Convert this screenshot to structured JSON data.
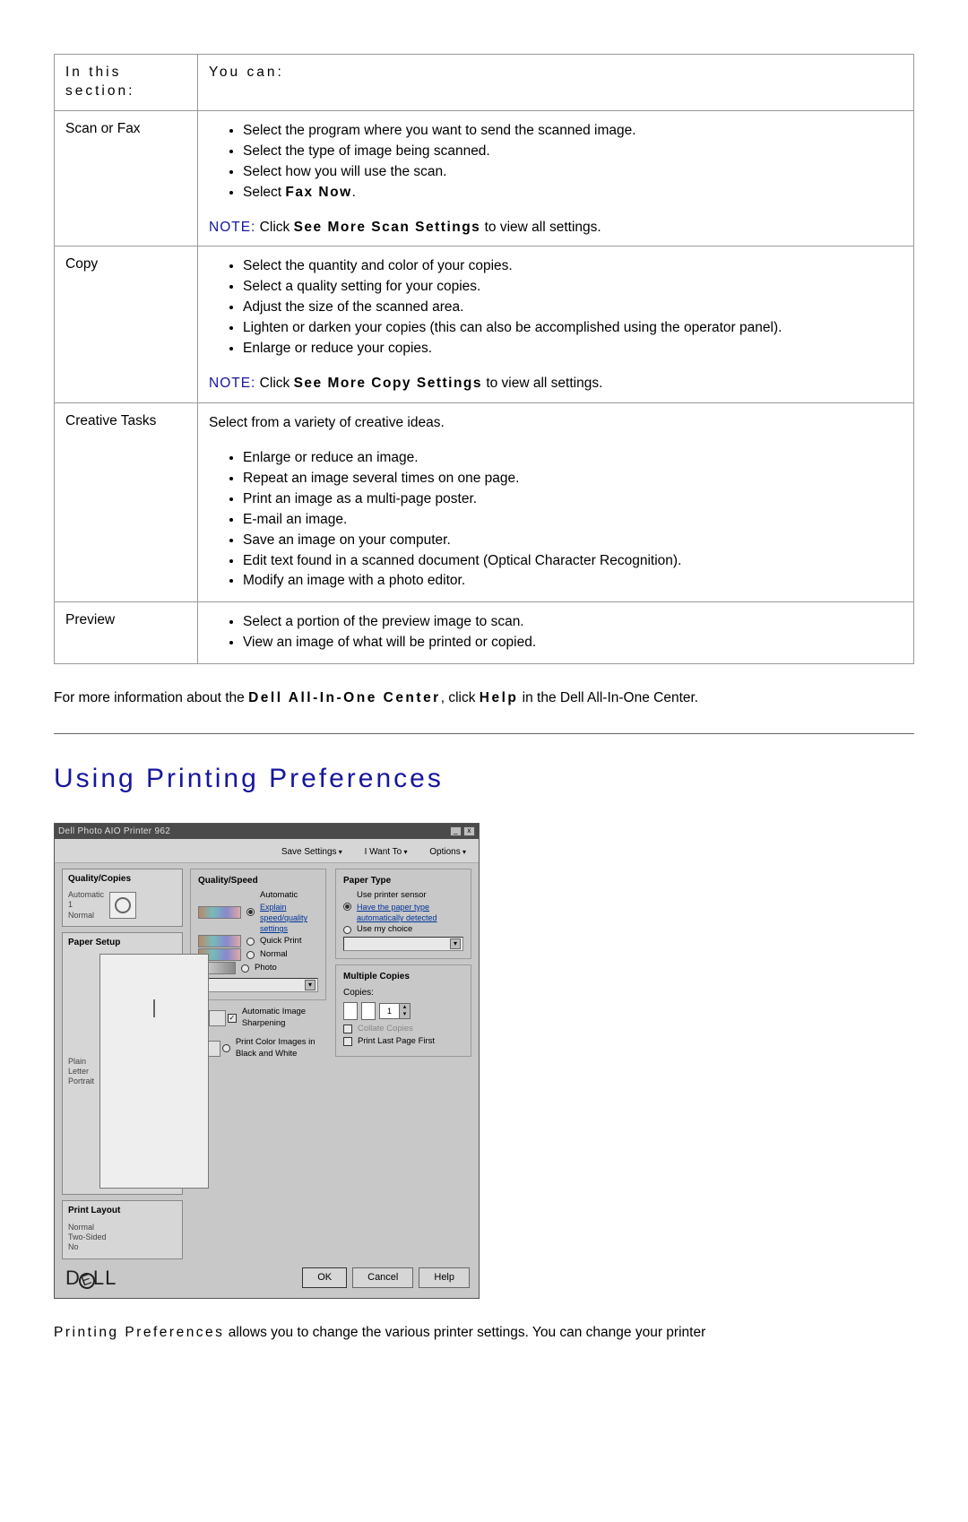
{
  "table": {
    "header": {
      "col1": "In this section:",
      "col2": "You can:"
    },
    "rows": {
      "scan": {
        "label": "Scan or Fax",
        "items": [
          "Select the program where you want to send the scanned image.",
          "Select the type of image being scanned.",
          "Select how you will use the scan."
        ],
        "last_pre": "Select ",
        "last_bold": "Fax Now",
        "last_post": ".",
        "note_label": "NOTE:",
        "note_pre": " Click ",
        "note_bold": "See More Scan Settings",
        "note_post": " to view all settings."
      },
      "copy": {
        "label": "Copy",
        "items": [
          "Select the quantity and color of your copies.",
          "Select a quality setting for your copies.",
          "Adjust the size of the scanned area.",
          "Lighten or darken your copies (this can also be accomplished using the operator panel).",
          "Enlarge or reduce your copies."
        ],
        "note_label": "NOTE:",
        "note_pre": " Click ",
        "note_bold": "See More Copy Settings",
        "note_post": " to view all settings."
      },
      "creative": {
        "label": "Creative Tasks",
        "intro": "Select from a variety of creative ideas.",
        "items": [
          "Enlarge or reduce an image.",
          "Repeat an image several times on one page.",
          "Print an image as a multi-page poster.",
          "E-mail an image.",
          "Save an image on your computer.",
          "Edit text found in a scanned document (Optical Character Recognition).",
          "Modify an image with a photo editor."
        ]
      },
      "preview": {
        "label": "Preview",
        "items": [
          "Select a portion of the preview image to scan.",
          "View an image of what will be printed or copied."
        ]
      }
    }
  },
  "more_info": {
    "pre": "For more information about the ",
    "bold1": "Dell All-In-One Center",
    "mid": ", click ",
    "bold2": "Help",
    "post": " in the Dell All-In-One Center."
  },
  "section_title": "Using Printing Preferences",
  "dialog": {
    "title": "Dell Photo AIO Printer 962",
    "win": {
      "min": "_",
      "close": "x"
    },
    "toolbar": {
      "save": "Save Settings",
      "want": "I Want To",
      "options": "Options"
    },
    "left": {
      "qc_title": "Quality/Copies",
      "qc_v1": "Automatic",
      "qc_v2": "1",
      "qc_v3": "Normal",
      "ps_title": "Paper Setup",
      "ps_v1": "Plain",
      "ps_v2": "Letter",
      "ps_v3": "Portrait",
      "pl_title": "Print Layout",
      "pl_v1": "Normal",
      "pl_v2": "Two-Sided",
      "pl_v3": "No"
    },
    "right": {
      "qs_title": "Quality/Speed",
      "qs_auto": "Automatic",
      "qs_link1": "Explain speed/quality settings",
      "qs_quick": "Quick Print",
      "qs_normal": "Normal",
      "qs_photo": "Photo",
      "img_sharp": "Automatic Image Sharpening",
      "img_bw": "Print Color Images in Black and White",
      "pt_title": "Paper Type",
      "pt_auto": "Use printer sensor",
      "pt_link": "Have the paper type automatically detected",
      "pt_manual": "Use my choice",
      "mc_title": "Multiple Copies",
      "mc_copies_lbl": "Copies:",
      "mc_copies_val": "1",
      "mc_collate": "Collate Copies",
      "mc_last": "Print Last Page First"
    },
    "buttons": {
      "ok": "OK",
      "cancel": "Cancel",
      "help": "Help"
    }
  },
  "desc": {
    "bold": "Printing Preferences",
    "rest": " allows you to change the various printer settings. You can change your printer"
  }
}
